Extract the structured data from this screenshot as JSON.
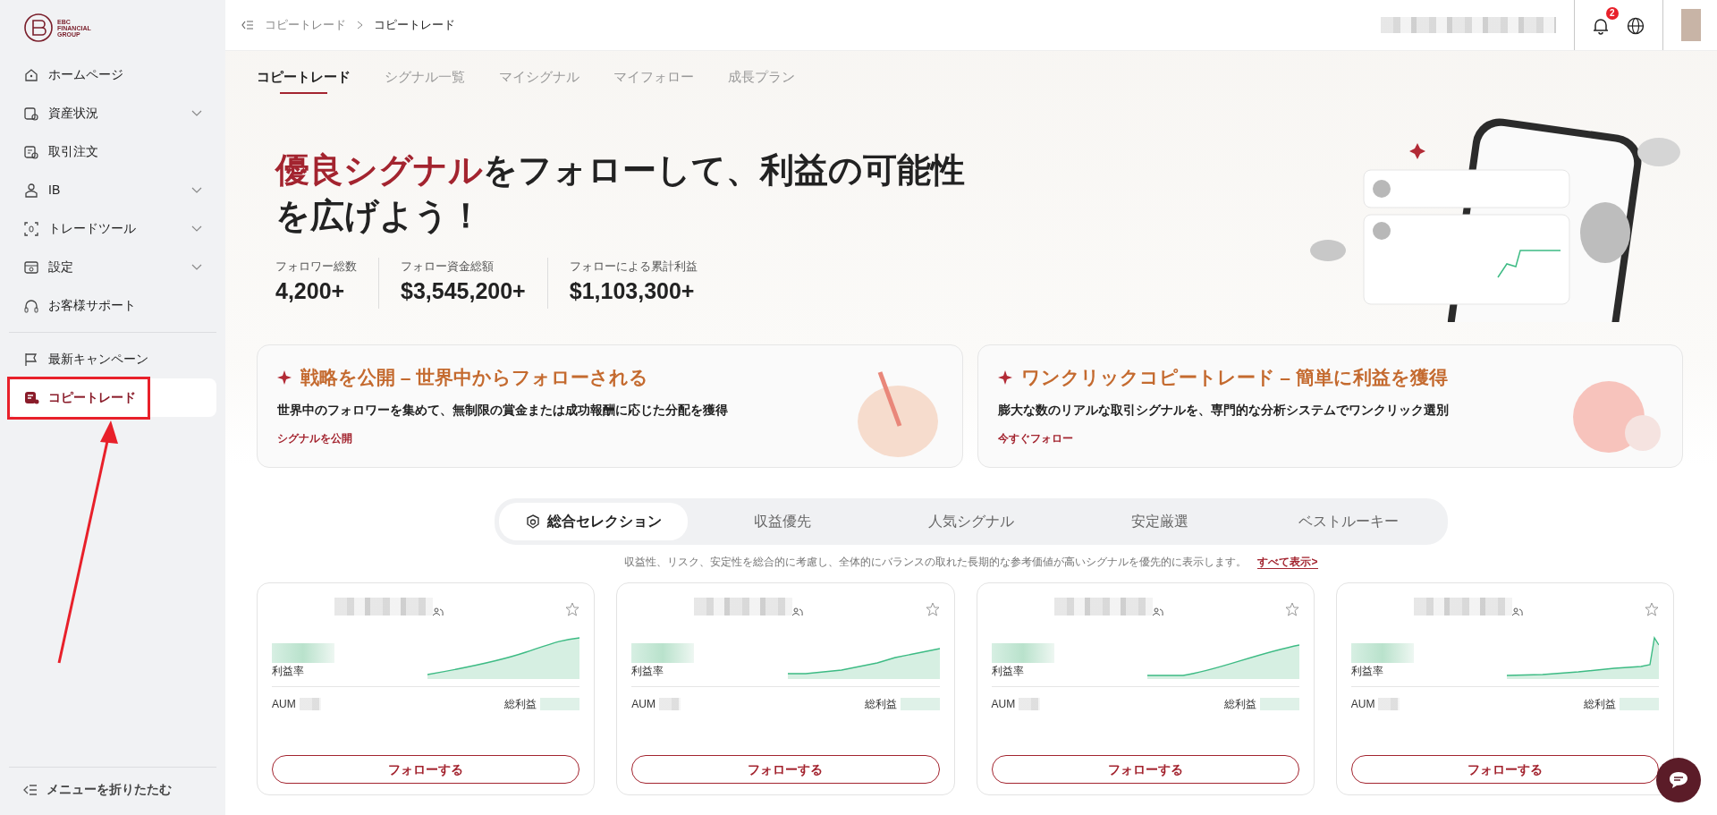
{
  "logo": {
    "lines": [
      "EBC",
      "FINANCIAL",
      "GROUP"
    ]
  },
  "sidebar": {
    "items": [
      {
        "label": "ホームページ",
        "expandable": false,
        "selected": false,
        "highlighted": false
      },
      {
        "label": "資産状況",
        "expandable": true,
        "selected": false,
        "highlighted": false
      },
      {
        "label": "取引注文",
        "expandable": false,
        "selected": false,
        "highlighted": false
      },
      {
        "label": "IB",
        "expandable": true,
        "selected": false,
        "highlighted": false
      },
      {
        "label": "トレードツール",
        "expandable": true,
        "selected": false,
        "highlighted": false
      },
      {
        "label": "設定",
        "expandable": true,
        "selected": false,
        "highlighted": false
      },
      {
        "label": "お客様サポート",
        "expandable": false,
        "selected": false,
        "highlighted": false
      }
    ],
    "extra_items": [
      {
        "label": "最新キャンペーン",
        "expandable": false,
        "selected": false,
        "highlighted": false
      },
      {
        "label": "コピートレード",
        "expandable": false,
        "selected": true,
        "highlighted": true
      }
    ],
    "collapse_label": "メニューを折りたたむ"
  },
  "breadcrumb": [
    "コピートレード",
    "コピートレード"
  ],
  "header": {
    "notification_count": "2"
  },
  "page_tabs": [
    {
      "label": "コピートレード",
      "selected": true
    },
    {
      "label": "シグナル一覧",
      "selected": false
    },
    {
      "label": "マイシグナル",
      "selected": false
    },
    {
      "label": "マイフォロー",
      "selected": false
    },
    {
      "label": "成長プラン",
      "selected": false
    }
  ],
  "hero": {
    "title_highlight": "優良シグナル",
    "title_rest": "をフォローして、利益の可能性を広げよう！",
    "stats": [
      {
        "label": "フォロワー総数",
        "value": "4,200+"
      },
      {
        "label": "フォロー資金総額",
        "value": "$3,545,200+"
      },
      {
        "label": "フォローによる累計利益",
        "value": "$1,103,300+"
      }
    ]
  },
  "features": [
    {
      "title": "戦略を公開 – 世界中からフォローされる",
      "description": "世界中のフォロワーを集めて、無制限の賞金または成功報酬に応じた分配を獲得",
      "link": "シグナルを公開"
    },
    {
      "title": "ワンクリックコピートレード – 簡単に利益を獲得",
      "description": "膨大な数のリアルな取引シグナルを、専門的な分析システムでワンクリック選別",
      "link": "今すぐフォロー"
    }
  ],
  "selection_tabs": [
    {
      "label": "総合セレクション",
      "selected": true
    },
    {
      "label": "収益優先",
      "selected": false
    },
    {
      "label": "人気シグナル",
      "selected": false
    },
    {
      "label": "安定厳選",
      "selected": false
    },
    {
      "label": "ベストルーキー",
      "selected": false
    }
  ],
  "selection_description": "収益性、リスク、安定性を総合的に考慮し、全体的にバランスの取れた長期的な参考価値が高いシグナルを優先的に表示します。",
  "show_all": "すべて表示>",
  "signals": [
    {
      "rate_label": "利益率",
      "aum_label": "AUM",
      "profit_label": "総利益",
      "follow_label": "フォローする",
      "favorited": false
    },
    {
      "rate_label": "利益率",
      "aum_label": "AUM",
      "profit_label": "総利益",
      "follow_label": "フォローする",
      "favorited": false
    },
    {
      "rate_label": "利益率",
      "aum_label": "AUM",
      "profit_label": "総利益",
      "follow_label": "フォローする",
      "favorited": false
    },
    {
      "rate_label": "利益率",
      "aum_label": "AUM",
      "profit_label": "総利益",
      "follow_label": "フォローする",
      "favorited": false
    }
  ]
}
